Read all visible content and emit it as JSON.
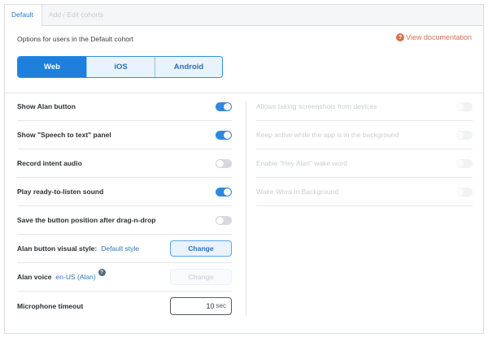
{
  "tabs": {
    "active": "Default",
    "inactive": "Add / Edit cohorts"
  },
  "header": {
    "options_text": "Options for users in the Default cohort",
    "doc_icon": "?",
    "doc_link": "View documentation"
  },
  "platforms": [
    {
      "label": "Web",
      "active": true
    },
    {
      "label": "iOS",
      "active": false
    },
    {
      "label": "Android",
      "active": false
    }
  ],
  "left_settings": {
    "show_button": {
      "label": "Show Alan button",
      "state": "on"
    },
    "speech_panel": {
      "label": "Show \"Speech to text\" panel",
      "state": "on"
    },
    "record_audio": {
      "label": "Record intent audio",
      "state": "off"
    },
    "ready_sound": {
      "label": "Play ready-to-listen sound",
      "state": "on"
    },
    "save_position": {
      "label": "Save the button position after drag-n-drop",
      "state": "off"
    },
    "visual_style": {
      "label": "Alan button visual style:",
      "value": "Default style",
      "button": "Change"
    },
    "voice": {
      "label": "Alan voice",
      "value": "en-US (Alan)",
      "help_icon": "?",
      "button": "Change"
    },
    "mic_timeout": {
      "label": "Microphone timeout",
      "value": "10",
      "unit": "sec"
    }
  },
  "right_settings": {
    "screenshots": {
      "label": "Allows taking screenshots from devices",
      "state": "disabled"
    },
    "keep_active": {
      "label": "Keep active while the app is in the background",
      "state": "disabled"
    },
    "wake_word": {
      "label": "Enable \"Hey Alan\" wake word",
      "state": "disabled"
    },
    "wake_word_bg": {
      "label": "Wake Word In Background",
      "state": "disabled"
    }
  },
  "colors": {
    "accent": "#1e7fdc",
    "link": "#d8704f",
    "toggle_on": "#2f88e0",
    "toggle_off": "#d6dade"
  }
}
